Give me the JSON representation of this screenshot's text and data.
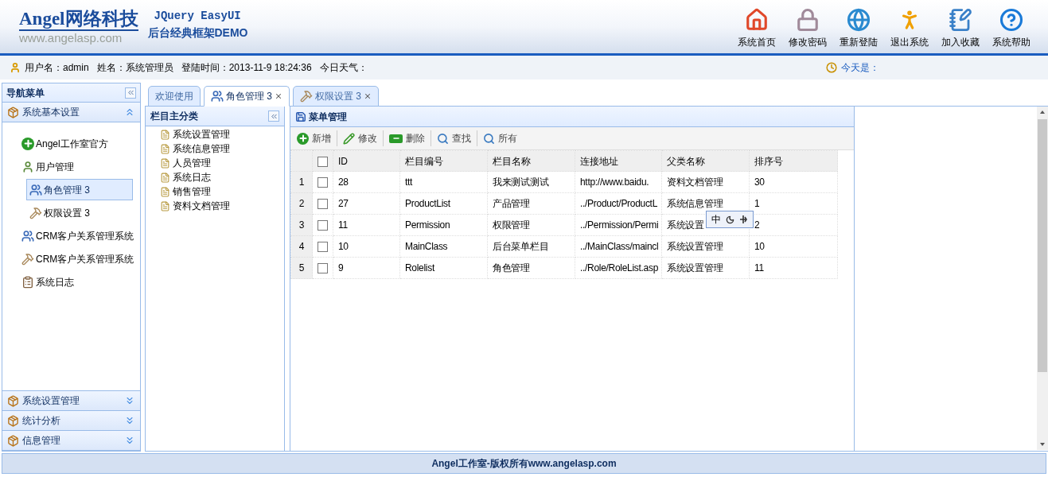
{
  "header": {
    "logo": "Angel网络科技",
    "logo_url": "www.angelasp.com",
    "subtitle_1": "JQuery EasyUI",
    "subtitle_2": "后台经典框架DEMO",
    "buttons": [
      {
        "kind": "home",
        "label": "系统首页"
      },
      {
        "kind": "lock",
        "label": "修改密码"
      },
      {
        "kind": "globe",
        "label": "重新登陆"
      },
      {
        "kind": "run",
        "label": "退出系统"
      },
      {
        "kind": "notebook",
        "label": "加入收藏"
      },
      {
        "kind": "help",
        "label": "系统帮助"
      }
    ]
  },
  "info_bar": {
    "user": "用户名：admin   姓名：系统管理员   登陆时间：2013-11-9 18:24:36   今日天气：",
    "today": "今天是："
  },
  "nav": {
    "title": "导航菜单",
    "panels": [
      {
        "title": "系统基本设置",
        "expanded": true,
        "items": [
          {
            "kind": "plus",
            "label": "Angel工作室官方",
            "selected": false
          },
          {
            "kind": "user",
            "label": "用户管理",
            "selected": false,
            "children": [
              {
                "kind": "users",
                "label": "角色管理 3",
                "selected": true
              },
              {
                "kind": "hammer",
                "label": "权限设置 3",
                "selected": false
              }
            ]
          },
          {
            "kind": "users",
            "label": "CRM客户关系管理系统",
            "selected": false
          },
          {
            "kind": "hammer",
            "label": "CRM客户关系管理系统",
            "selected": false
          },
          {
            "kind": "clipboard",
            "label": "系统日志",
            "selected": false
          }
        ]
      },
      {
        "title": "系统设置管理",
        "expanded": false
      },
      {
        "title": "统计分析",
        "expanded": false
      },
      {
        "title": "信息管理",
        "expanded": false
      }
    ]
  },
  "tabs": [
    {
      "label": "欢迎使用",
      "selected": false,
      "kind": "plain"
    },
    {
      "label": "角色管理 3",
      "selected": true,
      "kind": "users"
    },
    {
      "label": "权限设置 3",
      "selected": false,
      "kind": "hammer"
    }
  ],
  "category_panel": {
    "title": "栏目主分类",
    "items": [
      "系统设置管理",
      "系统信息管理",
      "人员管理",
      "系统日志",
      "销售管理",
      "资料文档管理"
    ]
  },
  "grid": {
    "title": "菜单管理",
    "toolbar": [
      {
        "kind": "add",
        "label": "新增"
      },
      {
        "kind": "edit",
        "label": "修改"
      },
      {
        "kind": "delete",
        "label": "删除"
      },
      {
        "kind": "search",
        "label": "查找"
      },
      {
        "kind": "search",
        "label": "所有"
      }
    ],
    "all_checked": false,
    "columns": [
      "ID",
      "栏目编号",
      "栏目名称",
      "连接地址",
      "父类名称",
      "排序号"
    ],
    "rows": [
      {
        "num": "1",
        "checked": false,
        "cells": [
          "28",
          "ttt",
          "我来测试测试",
          "http://www.baidu.",
          "资料文档管理",
          "30"
        ]
      },
      {
        "num": "2",
        "checked": false,
        "cells": [
          "27",
          "ProductList",
          "产品管理",
          "../Product/ProductL",
          "系统信息管理",
          "1"
        ]
      },
      {
        "num": "3",
        "checked": false,
        "cells": [
          "11",
          "Permission",
          "权限管理",
          "../Permission/Permi",
          "系统设置",
          "2"
        ]
      },
      {
        "num": "4",
        "checked": false,
        "cells": [
          "10",
          "MainClass",
          "后台菜单栏目",
          "../MainClass/maincl",
          "系统设置管理",
          "10"
        ]
      },
      {
        "num": "5",
        "checked": false,
        "cells": [
          "9",
          "Rolelist",
          "角色管理",
          "../Role/RoleList.asp",
          "系统设置管理",
          "11"
        ]
      }
    ]
  },
  "ime_bar": {
    "mode": "中"
  },
  "footer": "Angel工作室-版权所有www.angelasp.com"
}
